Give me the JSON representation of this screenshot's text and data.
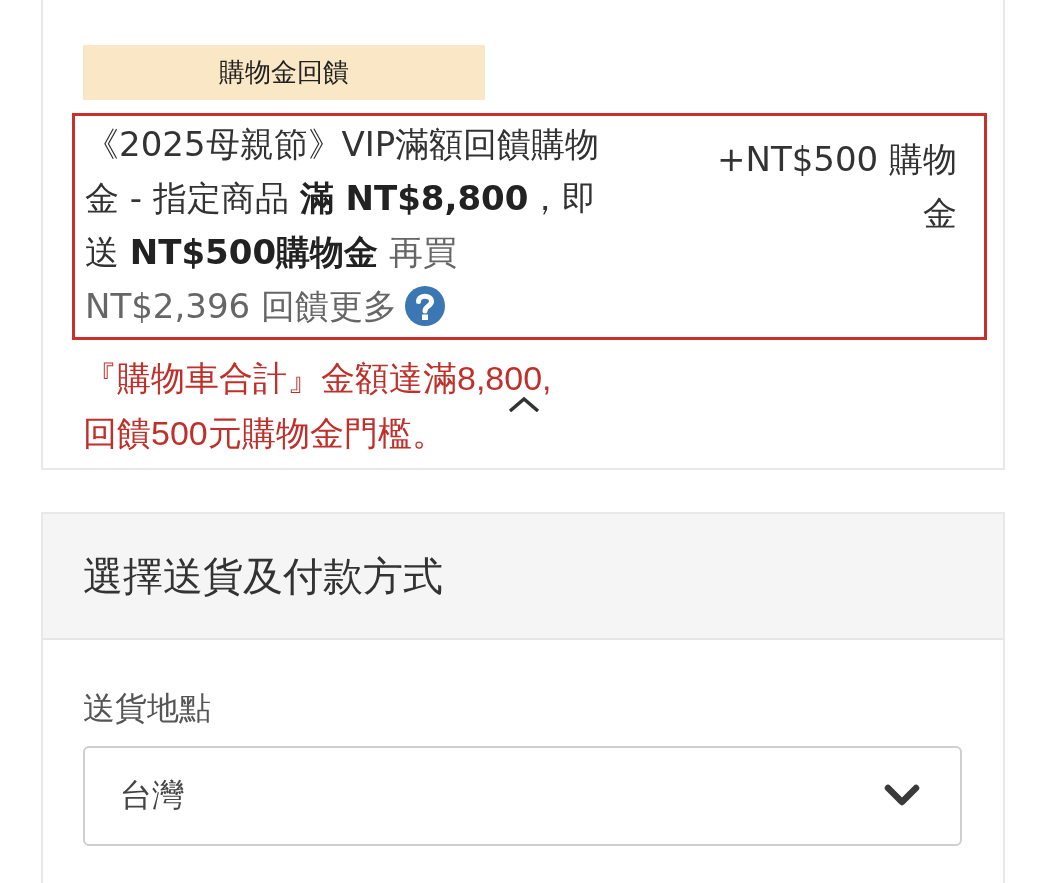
{
  "promo_card": {
    "badge": "購物金回饋",
    "offer": {
      "description": "《2025母親節》VIP滿額回饋購物金 - 指定商品 **滿 NT$8,800**，即送 **NT$500購物金**",
      "upsell_lead": "再買",
      "upsell": "NT$2,396 回饋更多",
      "reward": "+NT$500 購物金"
    },
    "expanded": true,
    "note_lines": [
      "『購物車合計』金額達滿8,800,",
      "回饋500元購物金門檻。"
    ]
  },
  "shipping_payment": {
    "title": "選擇送貨及付款方式",
    "fields": [
      {
        "label": "送貨地點",
        "value": "台灣"
      }
    ]
  }
}
